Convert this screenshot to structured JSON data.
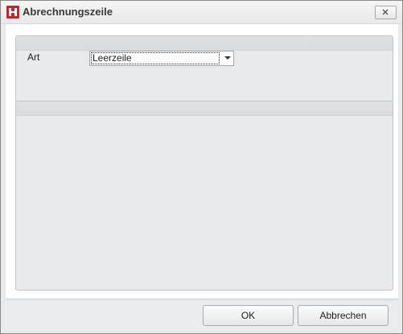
{
  "window": {
    "title": "Abrechnungszeile",
    "icon": "app-logo-icon",
    "close_icon": "close-icon"
  },
  "form": {
    "art_label": "Art",
    "art_value": "Leerzeile"
  },
  "buttons": {
    "ok_label": "OK",
    "cancel_label": "Abbrechen"
  },
  "colors": {
    "icon_red": "#c0272d",
    "panel_bg": "#e9eaec"
  }
}
